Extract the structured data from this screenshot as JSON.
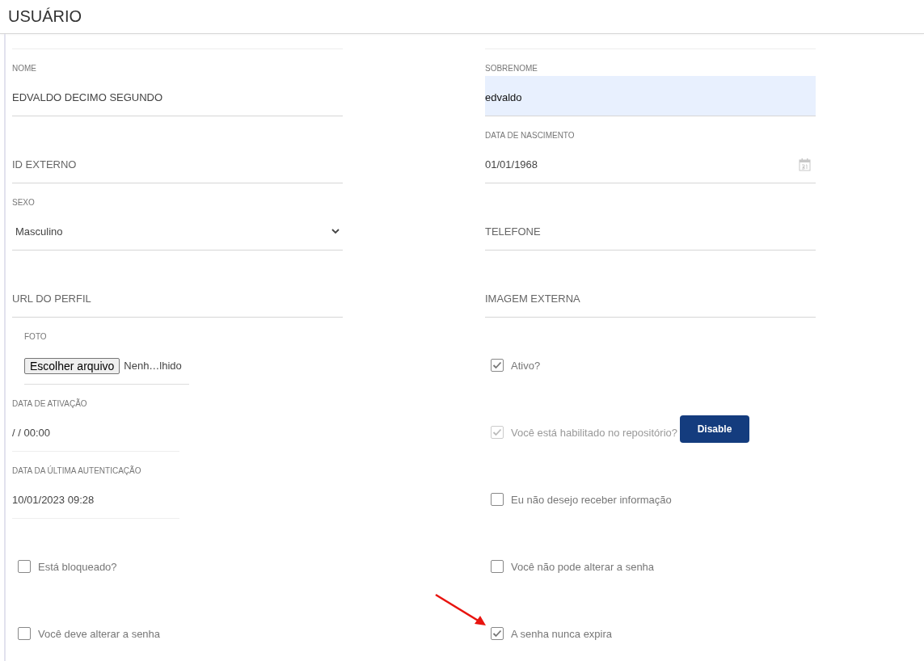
{
  "header": {
    "title": "USUÁRIO"
  },
  "left": [
    {
      "kind": "text",
      "label": "NOME",
      "value": "EDVALDO DECIMO SEGUNDO",
      "autofilled": false
    },
    {
      "kind": "placeholder",
      "placeholder": "ID EXTERNO"
    },
    {
      "kind": "select",
      "label": "SEXO",
      "value": "Masculino"
    },
    {
      "kind": "placeholder",
      "placeholder": "URL DO PERFIL"
    },
    {
      "kind": "file",
      "label": "FOTO",
      "button": "Escolher arquivo",
      "status": "Nenh…lhido"
    },
    {
      "kind": "datetime",
      "label": "DATA DE ATIVAÇÃO",
      "value": "/ / 00:00"
    },
    {
      "kind": "datetime",
      "label": "DATA DA ÚLTIMA AUTENTICAÇÃO",
      "value": "10/01/2023 09:28"
    },
    {
      "kind": "checkbox",
      "label": "Está bloqueado?",
      "checked": false,
      "disabled": false
    },
    {
      "kind": "checkbox",
      "label": "Você deve alterar a senha",
      "checked": false,
      "disabled": false
    }
  ],
  "right": [
    {
      "kind": "text",
      "label": "SOBRENOME",
      "value": "edvaldo",
      "autofilled": true
    },
    {
      "kind": "date",
      "label": "DATA DE NASCIMENTO",
      "value": "01/01/1968"
    },
    {
      "kind": "placeholder",
      "placeholder": "TELEFONE"
    },
    {
      "kind": "placeholder",
      "placeholder": "IMAGEM EXTERNA"
    },
    {
      "kind": "checkbox",
      "label": "Ativo?",
      "checked": true,
      "disabled": false
    },
    {
      "kind": "checkbox",
      "label": "Você está habilitado no repositório?",
      "checked": true,
      "disabled": true,
      "button": "Disable"
    },
    {
      "kind": "checkbox",
      "label": "Eu não desejo receber informação",
      "checked": false,
      "disabled": false
    },
    {
      "kind": "checkbox",
      "label": "Você não pode alterar a senha",
      "checked": false,
      "disabled": false
    },
    {
      "kind": "checkbox",
      "label": "A senha nunca expira",
      "checked": true,
      "disabled": false
    }
  ]
}
